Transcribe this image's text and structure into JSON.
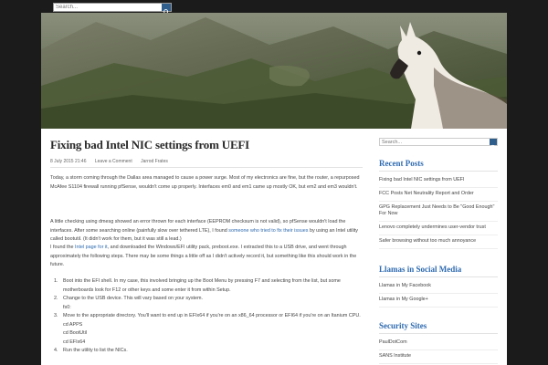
{
  "topbar": {
    "search_placeholder": "Search..."
  },
  "post": {
    "title": "Fixing bad Intel NIC settings from UEFI",
    "date": "8 July 2015 21:46",
    "comments": "Leave a Comment",
    "author": "Jarrod Frates",
    "p1": "Today, a storm coming through the Dallas area managed to cause a power surge.  Most of my electronics are fine, but the router, a repurposed McAfee S1104 firewall running pfSense, wouldn't come up properly.  Interfaces em0 and em1 came up mostly OK, but em2 and em3 wouldn't.",
    "p2a": "A little checking using dmesg showed an error thrown for each interface (EEPROM checksum is not valid), so pfSense wouldn't load the interfaces.  After some searching online (painfully slow over tethered LTE), I found ",
    "p2link": "someone who tried to fix their issues",
    "p2b": " by using an Intel utility called bootutil.  (It didn't work for them, but it was still a lead.)",
    "p3a": "I found the ",
    "p3link": "Intel page for it",
    "p3b": ", and downloaded the Windows/EFI utility pack, preboot.exe.  I extracted this to a USB drive, and went through approximately the following steps.  There may be some things a little off as I didn't actively record it, but something like this should work in the future.",
    "steps": [
      {
        "num": "1.",
        "text": "Boot into the EFI shell.  In my case, this involved bringing up the Boot Menu by pressing F7 and selecting from the list, but some motherboards look for F12 or other keys and some enter it from within Setup.",
        "cmds": []
      },
      {
        "num": "2.",
        "text": "Change to the USB device.  This will vary based on your system.",
        "cmds": [
          "fs0:"
        ]
      },
      {
        "num": "3.",
        "text": "Move to the appropriate directory.  You'll want to end up in EFIx64 if you're on an x86_64 processor or EFI64 if you're on an Itanium CPU.",
        "cmds": [
          "cd APPS",
          "cd BootUtil",
          "cd EFIx64"
        ]
      },
      {
        "num": "4.",
        "text": "Run the utility to list the NICs.",
        "cmds": []
      }
    ]
  },
  "sidebar": {
    "search_placeholder": "Search...",
    "recent": {
      "title": "Recent Posts",
      "items": [
        "Fixing bad Intel NIC settings from UEFI",
        "FCC Posts Net Neutrality Report and Order",
        "GPG Replacement Just Needs to Be \"Good Enough\" For Now",
        "Lenovo completely undermines user-vendor trust",
        "Safer browsing without too much annoyance"
      ]
    },
    "social": {
      "title": "Llamas in Social Media",
      "items": [
        "Llamas in My Facebook",
        "Llamas in My Google+"
      ]
    },
    "security": {
      "title": "Security Sites",
      "items": [
        "PaulDotCom",
        "SANS Institute"
      ]
    }
  }
}
